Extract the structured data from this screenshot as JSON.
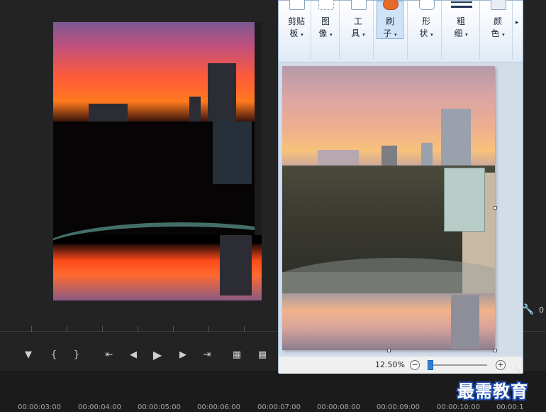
{
  "editor": {
    "transport_icons": [
      "marker-icon",
      "mark-in-icon",
      "mark-out-icon",
      "go-to-in-icon",
      "step-back-icon",
      "play-icon",
      "step-forward-icon",
      "go-to-out-icon",
      "insert-icon",
      "overwrite-icon"
    ],
    "right_value": "0",
    "timecodes": [
      "00:00:03:00",
      "00:00:04:00",
      "00:00:05:00",
      "00:00:06:00",
      "00:00:07:00",
      "00:00:08:00",
      "00:00:09:00",
      "00:00:10:00",
      "00:00:1"
    ]
  },
  "paint": {
    "ribbon": {
      "groups": [
        {
          "label_line1": "剪贴",
          "label_line2": "板"
        },
        {
          "label_line1": "图",
          "label_line2": "像"
        },
        {
          "label_line1": "工",
          "label_line2": "具"
        },
        {
          "label_line1": "刷",
          "label_line2": "子",
          "active": true
        },
        {
          "label_line1": "形",
          "label_line2": "状"
        },
        {
          "label_line1": "粗",
          "label_line2": "细"
        },
        {
          "label_line1": "颜",
          "label_line2": "色"
        }
      ],
      "dropdown_glyph": "▾",
      "more_glyph": "▸"
    },
    "status": {
      "zoom": "12.50%",
      "zoom_fraction": 0.0,
      "minus": "−",
      "plus": "+"
    }
  },
  "watermark": "最需教育"
}
